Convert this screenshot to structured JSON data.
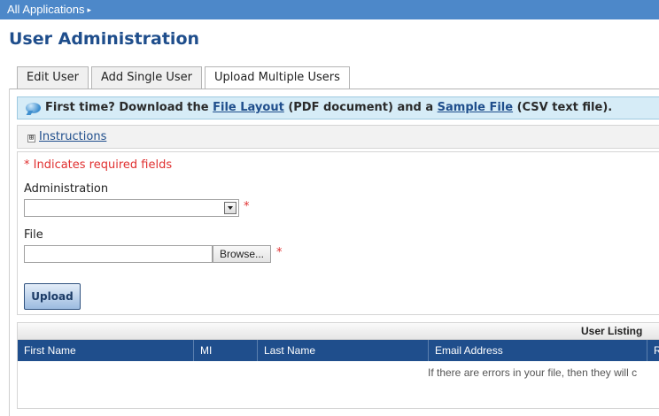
{
  "nav": {
    "breadcrumb": "All Applications",
    "breadcrumb_arrow": "▸"
  },
  "page": {
    "title": "User Administration"
  },
  "tabs": [
    {
      "label": "Edit User",
      "active": false
    },
    {
      "label": "Add Single User",
      "active": false
    },
    {
      "label": "Upload Multiple Users",
      "active": true
    }
  ],
  "banner": {
    "prefix": "First time? Download the ",
    "file_layout_link": "File Layout",
    "middle": " (PDF document) and a ",
    "sample_file_link": "Sample File",
    "suffix": " (CSV text file)."
  },
  "instructions": {
    "toggle": "⊞",
    "label": "Instructions"
  },
  "form": {
    "required_note": "* Indicates required fields",
    "required_marker": "*",
    "administration_label": "Administration",
    "administration_value": "",
    "file_label": "File",
    "file_value": "",
    "browse_label": "Browse...",
    "upload_label": "Upload"
  },
  "listing": {
    "title": "User Listing",
    "columns": [
      "First Name",
      "MI",
      "Last Name",
      "Email Address",
      "R"
    ],
    "empty_message": "If there are errors in your file, then they will c"
  },
  "colors": {
    "topbar": "#4d88c9",
    "title": "#1f4e8c",
    "header": "#1f4e8c",
    "required": "#e03030",
    "banner": "#d6ecf7"
  }
}
